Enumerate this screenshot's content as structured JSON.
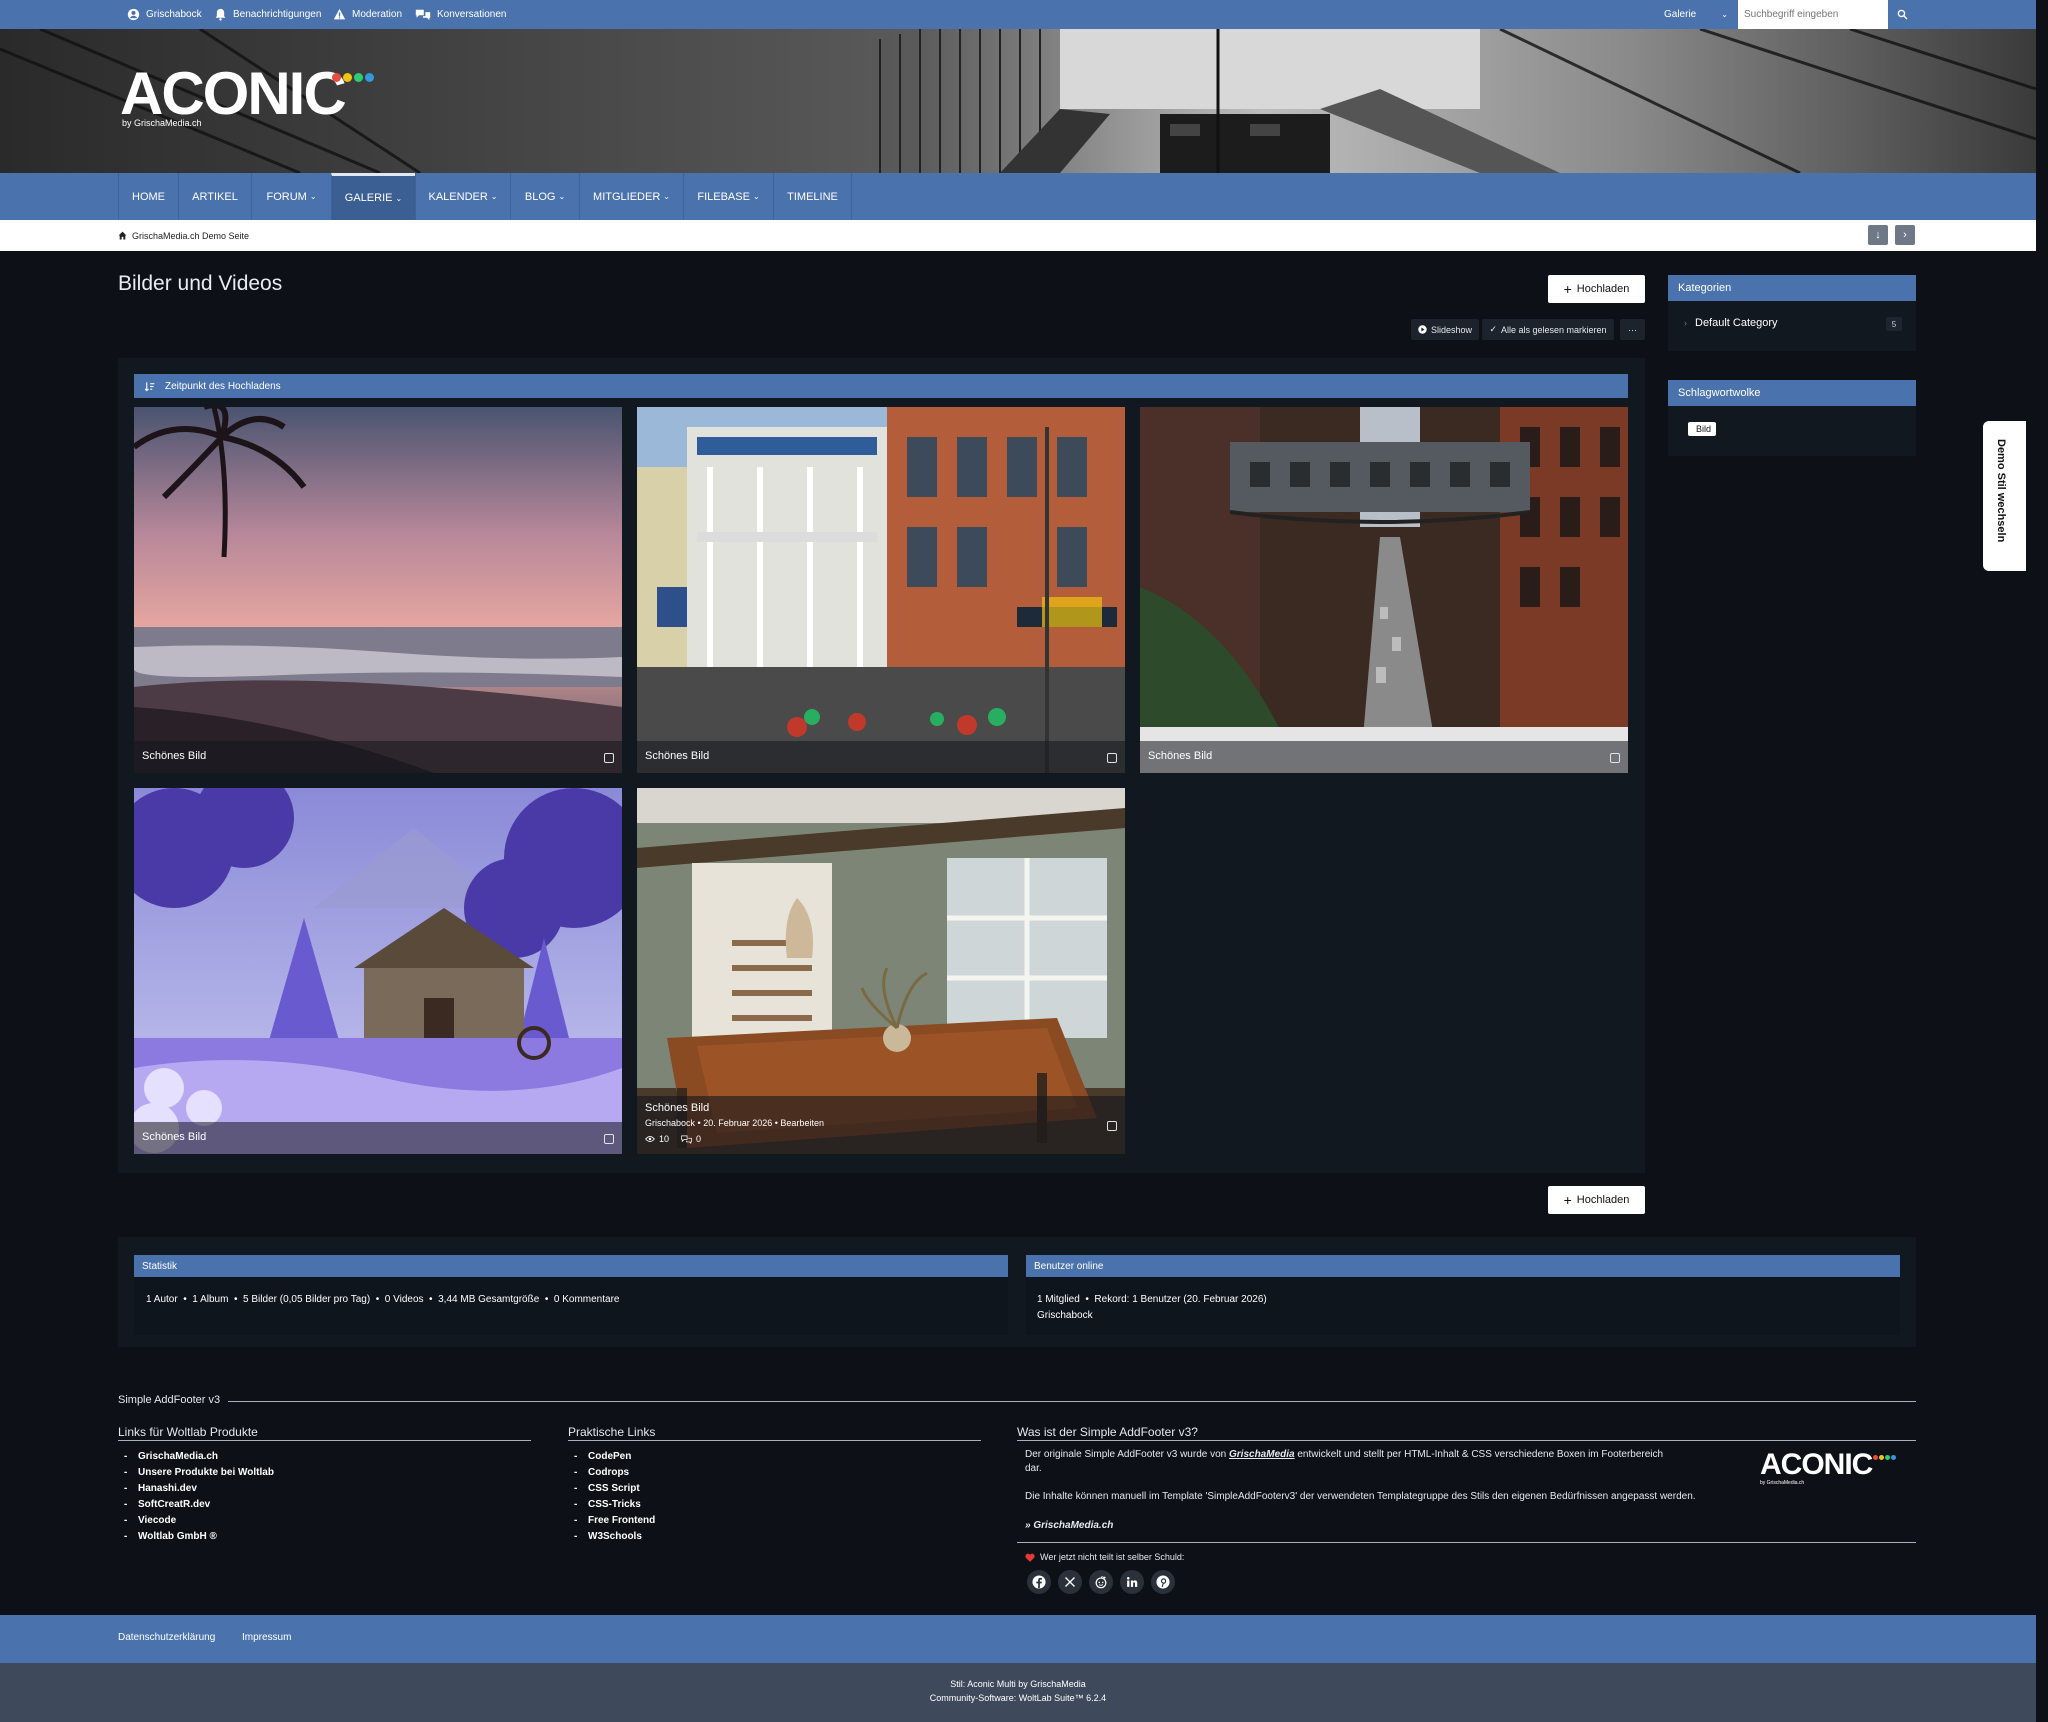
{
  "topbar": {
    "user": "Grischabock",
    "notifications": "Benachrichtigungen",
    "moderation": "Moderation",
    "conversations": "Konversationen",
    "search_scope": "Galerie",
    "search_placeholder": "Suchbegriff eingeben"
  },
  "logo": {
    "title": "ACONIC",
    "subtitle": "by GrischaMedia.ch",
    "dot_colors": [
      "#e74c3c",
      "#f1c40f",
      "#2ecc71",
      "#3498db"
    ]
  },
  "nav": {
    "items": [
      {
        "label": "HOME"
      },
      {
        "label": "ARTIKEL"
      },
      {
        "label": "FORUM"
      },
      {
        "label": "GALERIE"
      },
      {
        "label": "KALENDER"
      },
      {
        "label": "BLOG"
      },
      {
        "label": "MITGLIEDER"
      },
      {
        "label": "FILEBASE"
      },
      {
        "label": "TIMELINE"
      }
    ],
    "active": "GALERIE"
  },
  "breadcrumb": {
    "home": "GrischaMedia.ch Demo Seite"
  },
  "page": {
    "title": "Bilder und Videos",
    "upload_label": "Hochladen",
    "slideshow_label": "Slideshow",
    "mark_read_label": "Alle als gelesen markieren",
    "more_label": "···",
    "sort_label": "Zeitpunkt des Hochladens"
  },
  "gallery": {
    "items": [
      {
        "title": "Schönes Bild"
      },
      {
        "title": "Schönes Bild"
      },
      {
        "title": "Schönes Bild"
      },
      {
        "title": "Schönes Bild"
      },
      {
        "title": "Schönes Bild",
        "author": "Grischabock",
        "date": "20. Februar 2026",
        "edit": "Bearbeiten",
        "views": "10",
        "comments": "0"
      }
    ]
  },
  "sidebar": {
    "categories_title": "Kategorien",
    "category_name": "Default Category",
    "category_count": "5",
    "tags_title": "Schlagwortwolke",
    "tag": "Bild"
  },
  "demo_tab": "Demo Stil wechseln",
  "stats": {
    "title": "Statistik",
    "text": "1 Autor  •  1 Album  •  5 Bilder (0,05 Bilder pro Tag)  •  0 Videos  •  3,44 MB Gesamtgröße  •  0 Kommentare"
  },
  "online": {
    "title": "Benutzer online",
    "text": "1 Mitglied  •  Rekord: 1 Benutzer (20. Februar 2026)",
    "user": "Grischabock"
  },
  "footer": {
    "section_title": "Simple AddFooter v3",
    "col1_title": "Links für Woltlab Produkte",
    "col1_links": [
      "GrischaMedia.ch",
      "Unsere Produkte bei Woltlab",
      "Hanashi.dev",
      "SoftCreatR.dev",
      "Viecode",
      "Woltlab GmbH ®"
    ],
    "col2_title": "Praktische Links",
    "col2_links": [
      "CodePen",
      "Codrops",
      "CSS Script",
      "CSS-Tricks",
      "Free Frontend",
      "W3Schools"
    ],
    "col3_title": "Was ist der Simple AddFooter v3?",
    "col3_p1_a": "Der originale Simple AddFooter v3 wurde von ",
    "col3_p1_brand": "GrischaMedia",
    "col3_p1_b": " entwickelt und stellt per HTML-Inhalt & CSS verschiedene Boxen im Footerbereich",
    "col3_p1_c": "dar.",
    "col3_p2": "Die Inhalte können manuell im Template 'SimpleAddFooterv3' der verwendeten Templategruppe des Stils den eigenen Bedürfnissen angepasst werden.",
    "col3_link": "» GrischaMedia.ch",
    "share_text": "Wer jetzt nicht teilt ist selber Schuld:",
    "logo_title": "ACONIC",
    "logo_sub": "by GrischaMedia.ch",
    "social_icons": [
      "facebook-icon",
      "x-icon",
      "reddit-icon",
      "linkedin-icon",
      "pinterest-icon"
    ]
  },
  "bottom_nav": {
    "privacy": "Datenschutzerklärung",
    "imprint": "Impressum"
  },
  "copyright": {
    "line1": "Stil: Aconic Multi by GrischaMedia",
    "line2": "Community-Software: WoltLab Suite™ 6.2.4"
  },
  "colors": {
    "accent": "#4a72ad",
    "background": "#0d1117",
    "panel": "#111820"
  }
}
